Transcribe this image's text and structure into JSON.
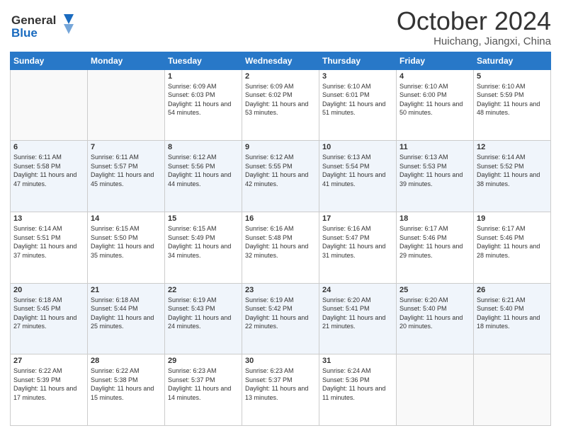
{
  "logo": {
    "line1": "General",
    "line2": "Blue"
  },
  "header": {
    "month": "October 2024",
    "location": "Huichang, Jiangxi, China"
  },
  "weekdays": [
    "Sunday",
    "Monday",
    "Tuesday",
    "Wednesday",
    "Thursday",
    "Friday",
    "Saturday"
  ],
  "weeks": [
    [
      {
        "day": "",
        "info": ""
      },
      {
        "day": "",
        "info": ""
      },
      {
        "day": "1",
        "info": "Sunrise: 6:09 AM\nSunset: 6:03 PM\nDaylight: 11 hours and 54 minutes."
      },
      {
        "day": "2",
        "info": "Sunrise: 6:09 AM\nSunset: 6:02 PM\nDaylight: 11 hours and 53 minutes."
      },
      {
        "day": "3",
        "info": "Sunrise: 6:10 AM\nSunset: 6:01 PM\nDaylight: 11 hours and 51 minutes."
      },
      {
        "day": "4",
        "info": "Sunrise: 6:10 AM\nSunset: 6:00 PM\nDaylight: 11 hours and 50 minutes."
      },
      {
        "day": "5",
        "info": "Sunrise: 6:10 AM\nSunset: 5:59 PM\nDaylight: 11 hours and 48 minutes."
      }
    ],
    [
      {
        "day": "6",
        "info": "Sunrise: 6:11 AM\nSunset: 5:58 PM\nDaylight: 11 hours and 47 minutes."
      },
      {
        "day": "7",
        "info": "Sunrise: 6:11 AM\nSunset: 5:57 PM\nDaylight: 11 hours and 45 minutes."
      },
      {
        "day": "8",
        "info": "Sunrise: 6:12 AM\nSunset: 5:56 PM\nDaylight: 11 hours and 44 minutes."
      },
      {
        "day": "9",
        "info": "Sunrise: 6:12 AM\nSunset: 5:55 PM\nDaylight: 11 hours and 42 minutes."
      },
      {
        "day": "10",
        "info": "Sunrise: 6:13 AM\nSunset: 5:54 PM\nDaylight: 11 hours and 41 minutes."
      },
      {
        "day": "11",
        "info": "Sunrise: 6:13 AM\nSunset: 5:53 PM\nDaylight: 11 hours and 39 minutes."
      },
      {
        "day": "12",
        "info": "Sunrise: 6:14 AM\nSunset: 5:52 PM\nDaylight: 11 hours and 38 minutes."
      }
    ],
    [
      {
        "day": "13",
        "info": "Sunrise: 6:14 AM\nSunset: 5:51 PM\nDaylight: 11 hours and 37 minutes."
      },
      {
        "day": "14",
        "info": "Sunrise: 6:15 AM\nSunset: 5:50 PM\nDaylight: 11 hours and 35 minutes."
      },
      {
        "day": "15",
        "info": "Sunrise: 6:15 AM\nSunset: 5:49 PM\nDaylight: 11 hours and 34 minutes."
      },
      {
        "day": "16",
        "info": "Sunrise: 6:16 AM\nSunset: 5:48 PM\nDaylight: 11 hours and 32 minutes."
      },
      {
        "day": "17",
        "info": "Sunrise: 6:16 AM\nSunset: 5:47 PM\nDaylight: 11 hours and 31 minutes."
      },
      {
        "day": "18",
        "info": "Sunrise: 6:17 AM\nSunset: 5:46 PM\nDaylight: 11 hours and 29 minutes."
      },
      {
        "day": "19",
        "info": "Sunrise: 6:17 AM\nSunset: 5:46 PM\nDaylight: 11 hours and 28 minutes."
      }
    ],
    [
      {
        "day": "20",
        "info": "Sunrise: 6:18 AM\nSunset: 5:45 PM\nDaylight: 11 hours and 27 minutes."
      },
      {
        "day": "21",
        "info": "Sunrise: 6:18 AM\nSunset: 5:44 PM\nDaylight: 11 hours and 25 minutes."
      },
      {
        "day": "22",
        "info": "Sunrise: 6:19 AM\nSunset: 5:43 PM\nDaylight: 11 hours and 24 minutes."
      },
      {
        "day": "23",
        "info": "Sunrise: 6:19 AM\nSunset: 5:42 PM\nDaylight: 11 hours and 22 minutes."
      },
      {
        "day": "24",
        "info": "Sunrise: 6:20 AM\nSunset: 5:41 PM\nDaylight: 11 hours and 21 minutes."
      },
      {
        "day": "25",
        "info": "Sunrise: 6:20 AM\nSunset: 5:40 PM\nDaylight: 11 hours and 20 minutes."
      },
      {
        "day": "26",
        "info": "Sunrise: 6:21 AM\nSunset: 5:40 PM\nDaylight: 11 hours and 18 minutes."
      }
    ],
    [
      {
        "day": "27",
        "info": "Sunrise: 6:22 AM\nSunset: 5:39 PM\nDaylight: 11 hours and 17 minutes."
      },
      {
        "day": "28",
        "info": "Sunrise: 6:22 AM\nSunset: 5:38 PM\nDaylight: 11 hours and 15 minutes."
      },
      {
        "day": "29",
        "info": "Sunrise: 6:23 AM\nSunset: 5:37 PM\nDaylight: 11 hours and 14 minutes."
      },
      {
        "day": "30",
        "info": "Sunrise: 6:23 AM\nSunset: 5:37 PM\nDaylight: 11 hours and 13 minutes."
      },
      {
        "day": "31",
        "info": "Sunrise: 6:24 AM\nSunset: 5:36 PM\nDaylight: 11 hours and 11 minutes."
      },
      {
        "day": "",
        "info": ""
      },
      {
        "day": "",
        "info": ""
      }
    ]
  ]
}
